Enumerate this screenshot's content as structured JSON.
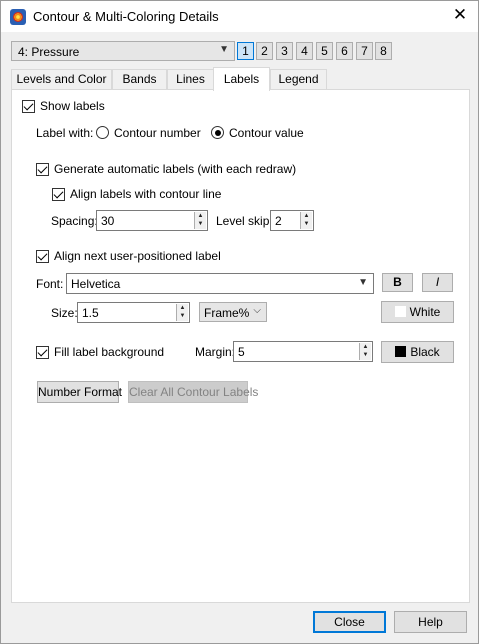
{
  "window": {
    "title": "Contour & Multi-Coloring Details",
    "close_glyph": "✕"
  },
  "variable_select": {
    "value": "4: Pressure"
  },
  "group_buttons": [
    "1",
    "2",
    "3",
    "4",
    "5",
    "6",
    "7",
    "8"
  ],
  "tabs": [
    "Levels and Color",
    "Bands",
    "Lines",
    "Labels",
    "Legend"
  ],
  "active_tab": "Labels",
  "labels_panel": {
    "show_labels": "Show labels",
    "label_with": "Label with:",
    "contour_number": "Contour number",
    "contour_value": "Contour value",
    "generate_auto": "Generate automatic labels (with each redraw)",
    "align_contour": "Align labels with contour line",
    "spacing_label": "Spacing:",
    "spacing_value": "30",
    "level_skip_label": "Level skip:",
    "level_skip_value": "2",
    "align_user": "Align next user-positioned label",
    "font_label": "Font:",
    "font_value": "Helvetica",
    "bold_btn": "B",
    "italic_btn": "I",
    "size_label": "Size:",
    "size_value": "1.5",
    "size_units": "Frame%",
    "text_color": "White",
    "fill_bg": "Fill label background",
    "margin_label": "Margin:",
    "margin_value": "5",
    "bg_color": "Black",
    "number_format": "Number Format",
    "clear_labels": "Clear All Contour Labels"
  },
  "footer": {
    "close": "Close",
    "help": "Help"
  },
  "colors": {
    "text_swatch": "#ffffff",
    "bg_swatch": "#000000",
    "accent": "#0078d7"
  }
}
